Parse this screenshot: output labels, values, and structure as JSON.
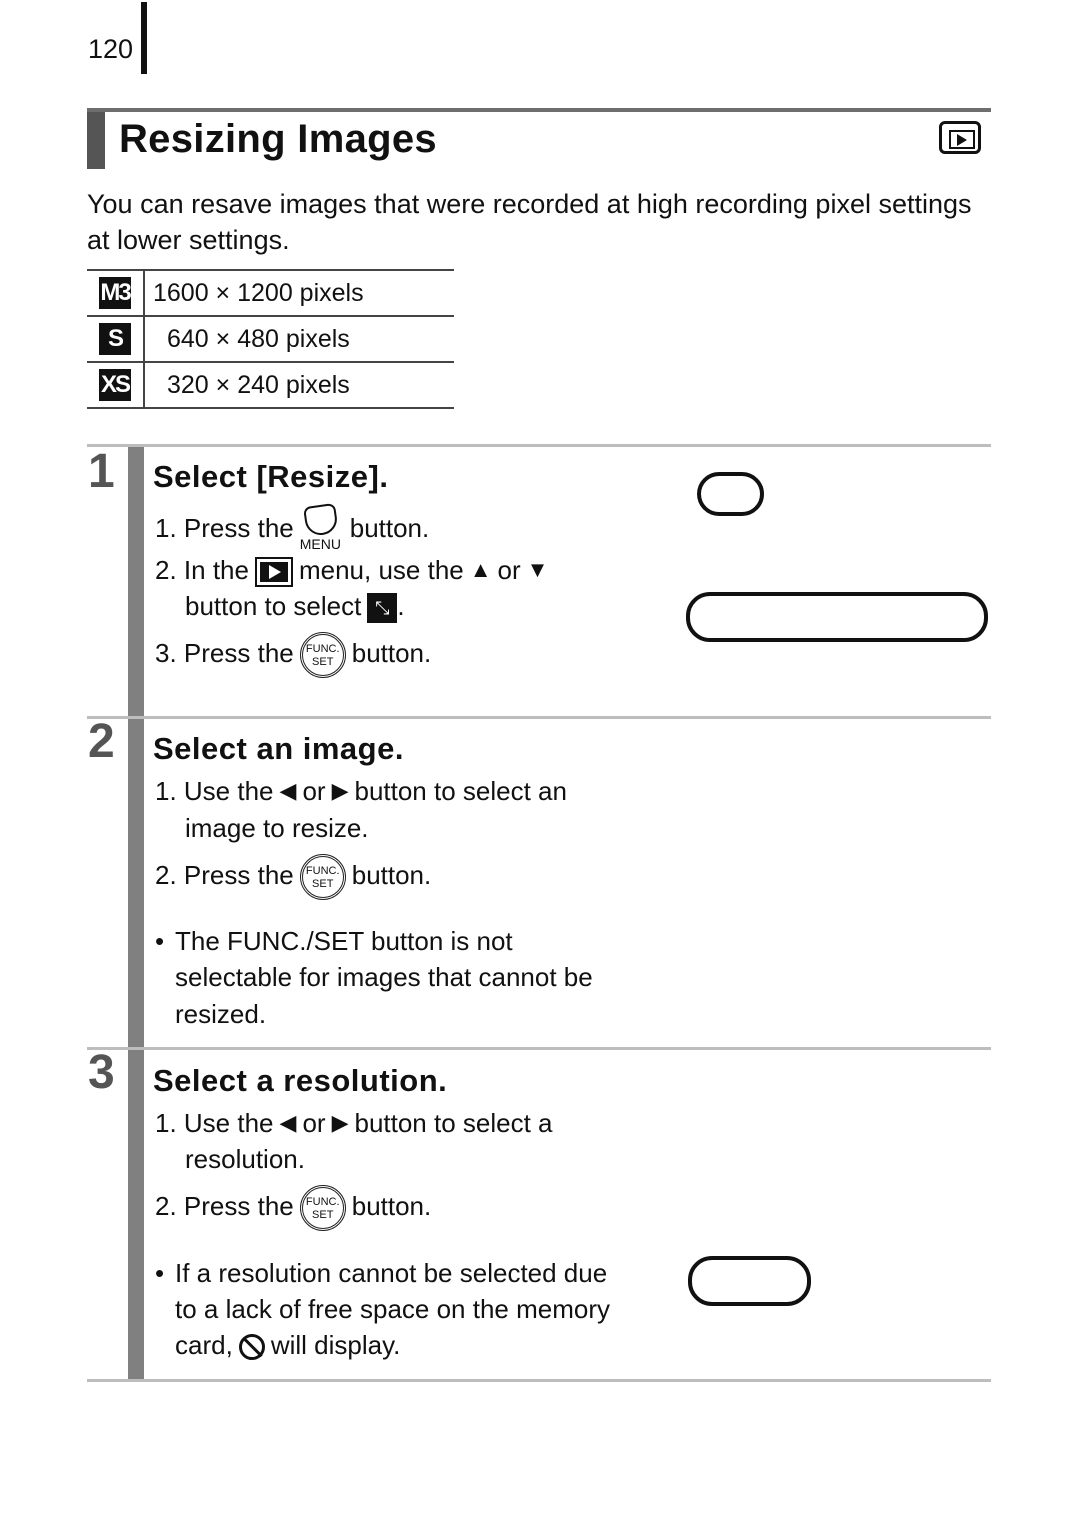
{
  "page_number": "120",
  "title": "Resizing Images",
  "mode_icon": "playback-mode-icon",
  "intro": "You can resave images that were recorded at high recording pixel settings at lower settings.",
  "resolutions": [
    {
      "icon": "M3",
      "label": "1600 × 1200 pixels"
    },
    {
      "icon": "S",
      "label": "640 × 480 pixels"
    },
    {
      "icon": "XS",
      "label": "320 × 240 pixels"
    }
  ],
  "steps": [
    {
      "number": "1",
      "title": "Select [Resize].",
      "lines": {
        "s1_prefix": "1. Press the",
        "s1_menu_label": "MENU",
        "s1_suffix": "button.",
        "s2_prefix": "2. In the",
        "s2_mid": "menu, use the",
        "s2_or": "or",
        "s2_cont": "button to select",
        "s2_end": ".",
        "s3_prefix": "3. Press the",
        "s3_suffix": "button."
      }
    },
    {
      "number": "2",
      "title": "Select an image.",
      "lines": {
        "s1_prefix": "1. Use the",
        "s1_or": "or",
        "s1_suffix": "button to select an",
        "s1_cont": "image to resize.",
        "s2_prefix": "2. Press the",
        "s2_suffix": "button.",
        "note_bullet": "•",
        "note_1": "The FUNC./SET button is not",
        "note_2": "selectable for images that cannot be",
        "note_3": "resized."
      }
    },
    {
      "number": "3",
      "title": "Select a resolution.",
      "lines": {
        "s1_prefix": "1. Use the",
        "s1_or": "or",
        "s1_suffix": "button to select a",
        "s1_cont": "resolution.",
        "s2_prefix": "2. Press the",
        "s2_suffix": "button.",
        "note_bullet": "•",
        "note_1": "If a resolution cannot be selected due",
        "note_2": "to a lack of free space on the memory",
        "note_3_prefix": "card,",
        "note_3_suffix": "will display."
      }
    }
  ],
  "icons": {
    "up": "▲",
    "down": "▼",
    "left": "◀",
    "right": "▶",
    "func_line1": "FUNC.",
    "func_line2": "SET",
    "resize": "⤡"
  }
}
